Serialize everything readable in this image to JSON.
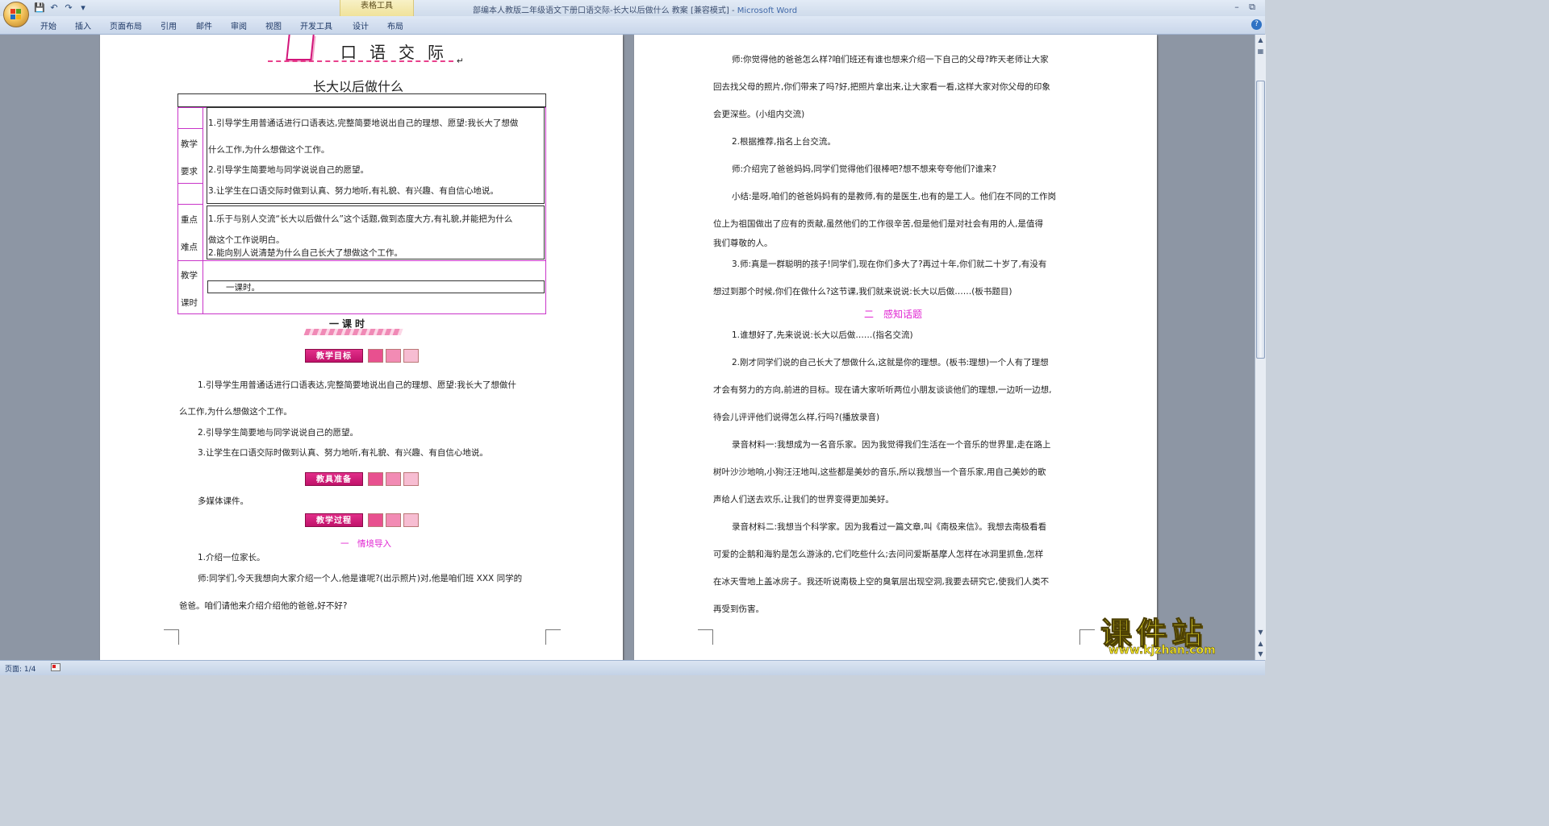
{
  "window": {
    "title_doc": "部编本人教版二年级语文下册口语交际-长大以后做什么 教案 [兼容模式] - ",
    "title_app": "Microsoft Word",
    "contextual_tab_group": "表格工具"
  },
  "ribbon": {
    "tabs": [
      "开始",
      "插入",
      "页面布局",
      "引用",
      "邮件",
      "审阅",
      "视图",
      "开发工具",
      "设计",
      "布局"
    ]
  },
  "page1": {
    "header_title": "口语交际",
    "doc_title": "长大以后做什么",
    "table": {
      "goals_label_1": "教学",
      "goals_label_2": "要求",
      "goal_1a": "1.引导学生用普通话进行口语表达,完整简要地说出自己的理想、愿望:我长大了想做",
      "goal_1b": "什么工作,为什么想做这个工作。",
      "goal_2": "2.引导学生简要地与同学说说自己的愿望。",
      "goal_3": "3.让学生在口语交际时做到认真、努力地听,有礼貌、有兴趣、有自信心地说。",
      "key_label_1": "重点",
      "key_label_2": "难点",
      "key_1a": "1.乐于与别人交流“长大以后做什么”这个话题,做到态度大方,有礼貌,并能把为什么",
      "key_1b": "做这个工作说明白。",
      "key_2": "2.能向别人说清楚为什么自己长大了想做这个工作。",
      "time_label_1": "教学",
      "time_label_2": "课时",
      "time_value": "一课时。"
    },
    "one_class": "一课时",
    "section_goal_tag": "教学目标",
    "goal_1a": "1.引导学生用普通话进行口语表达,完整简要地说出自己的理想、愿望:我长大了想做什",
    "goal_1b": "么工作,为什么想做这个工作。",
    "goal_2": "2.引导学生简要地与同学说说自己的愿望。",
    "goal_3": "3.让学生在口语交际时做到认真、努力地听,有礼貌、有兴趣、有自信心地说。",
    "section_prep_tag": "教具准备",
    "prep_text": "多媒体课件。",
    "section_process_tag": "教学过程",
    "step_1_heading": "一　情境导入",
    "step_1_item": "1.介绍一位家长。",
    "teacher_a": "师:同学们,今天我想向大家介绍一个人,他是谁呢?(出示照片)对,他是咱们班 XXX 同学的",
    "teacher_b": "爸爸。咱们请他来介绍介绍他的爸爸,好不好?"
  },
  "page2": {
    "lines": [
      "师:你觉得他的爸爸怎么样?咱们班还有谁也想来介绍一下自己的父母?昨天老师让大家",
      "回去找父母的照片,你们带来了吗?好,把照片拿出来,让大家看一看,这样大家对你父母的印象",
      "会更深些。(小组内交流)",
      "2.根据推荐,指名上台交流。",
      "师:介绍完了爸爸妈妈,同学们觉得他们很棒吧?想不想来夸夸他们?谁来?",
      "小结:是呀,咱们的爸爸妈妈有的是教师,有的是医生,也有的是工人。他们在不同的工作岗",
      "位上为祖国做出了应有的贡献,虽然他们的工作很辛苦,但是他们是对社会有用的人,是值得",
      "我们尊敬的人。",
      "3.师:真是一群聪明的孩子!同学们,现在你们多大了?再过十年,你们就二十岁了,有没有",
      "想过到那个时候,你们在做什么?这节课,我们就来说说:长大以后做……(板书题目)",
      "二　感知话题",
      "1.谁想好了,先来说说:长大以后做……(指名交流)",
      "2.刚才同学们说的自己长大了想做什么,这就是你的理想。(板书:理想)一个人有了理想",
      "才会有努力的方向,前进的目标。现在请大家听听两位小朋友谈谈他们的理想,一边听一边想,",
      "待会儿评评他们说得怎么样,行吗?(播放录音)",
      "录音材料一:我想成为一名音乐家。因为我觉得我们生活在一个音乐的世界里,走在路上",
      "树叶沙沙地响,小狗汪汪地叫,这些都是美妙的音乐,所以我想当一个音乐家,用自己美妙的歌",
      "声给人们送去欢乐,让我们的世界变得更加美好。",
      "录音材料二:我想当个科学家。因为我看过一篇文章,叫《南极来信》。我想去南极看看",
      "可爱的企鹅和海豹是怎么游泳的,它们吃些什么;去问问爱斯基摩人怎样在冰洞里抓鱼,怎样",
      "在冰天雪地上盖冰房子。我还听说南极上空的臭氧层出现空洞,我要去研究它,使我们人类不",
      "再受到伤害。"
    ]
  },
  "statusbar": {
    "page_info": "页面: 1/4"
  },
  "watermark": {
    "title": "课件站",
    "url": "www.kjzhan.com"
  },
  "colors": {
    "accent_pink": "#e026d2",
    "tag_pink": "#c0126a",
    "watermark_yellow": "#f4e62a"
  }
}
